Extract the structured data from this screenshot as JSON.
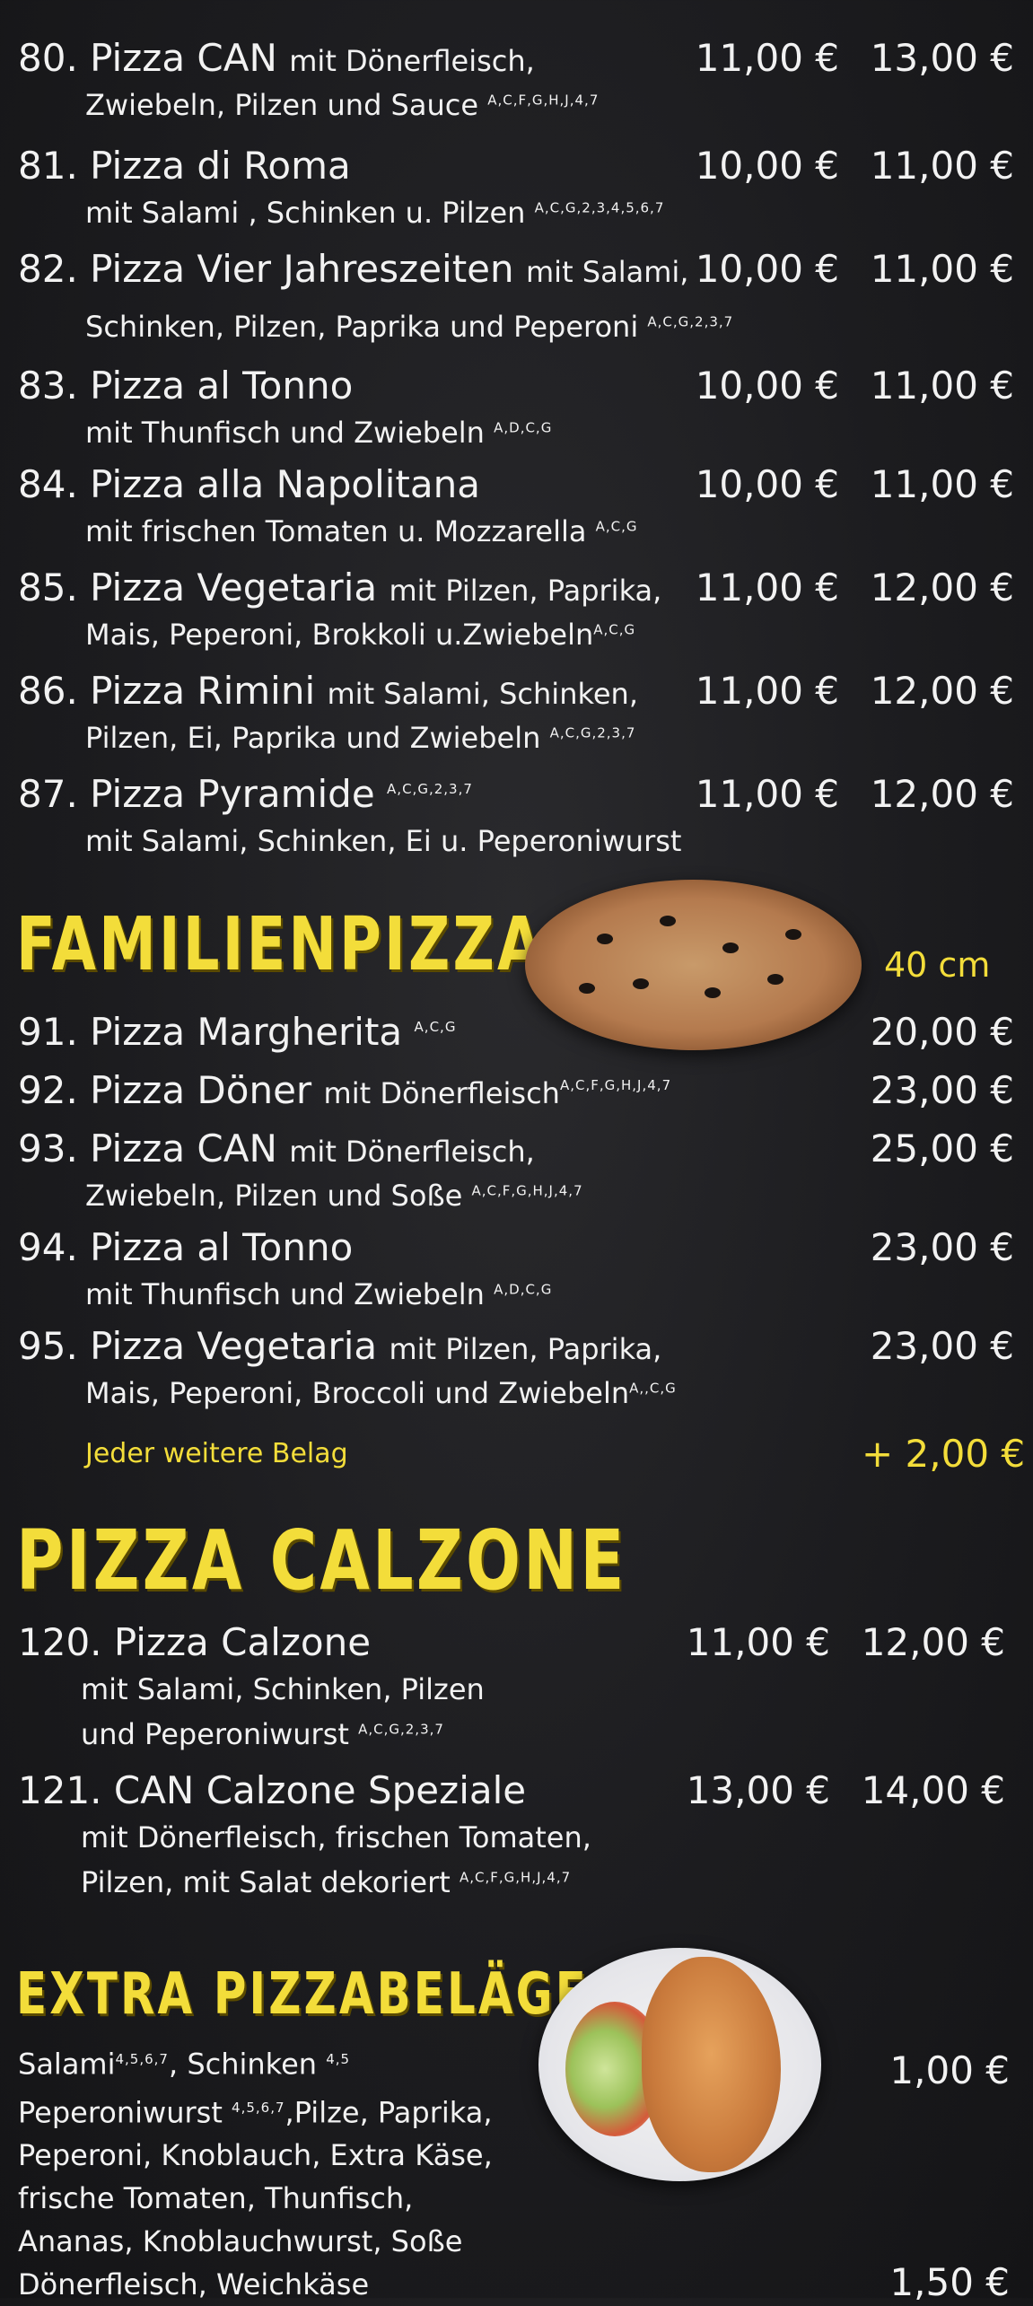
{
  "sections": {
    "normal_items": [
      {
        "num": "80.",
        "name": "Pizza CAN",
        "desc1": "mit Dönerfleisch,",
        "desc2": "Zwiebeln, Pilzen und  Sauce",
        "sup": "A,C,F,G,H,J,4,7",
        "price1": "11,00 €",
        "price2": "13,00 €"
      },
      {
        "num": "81.",
        "name": "Pizza di Roma",
        "desc2": "mit Salami , Schinken u. Pilzen",
        "sup": "A,C,G,2,3,4,5,6,7",
        "price1": "10,00 €",
        "price2": "11,00 €"
      },
      {
        "num": "82.",
        "name": "Pizza Vier Jahreszeiten",
        "desc1": "mit Salami,",
        "desc2": "Schinken, Pilzen, Paprika und Peperoni",
        "sup": "A,C,G,2,3,7",
        "price1": "10,00 €",
        "price2": "11,00 €"
      },
      {
        "num": "83.",
        "name": "Pizza al Tonno",
        "desc2": "mit Thunfisch und Zwiebeln",
        "sup": "A,D,C,G",
        "price1": "10,00 €",
        "price2": "11,00 €"
      },
      {
        "num": "84.",
        "name": "Pizza alla Napolitana",
        "desc2": "mit frischen Tomaten u. Mozzarella",
        "sup": "A,C,G",
        "price1": "10,00 €",
        "price2": "11,00 €"
      },
      {
        "num": "85.",
        "name": "Pizza Vegetaria",
        "desc1": "mit Pilzen, Paprika,",
        "desc2": "Mais, Peperoni, Brokkoli u.Zwiebeln",
        "sup": "A,C,G",
        "price1": "11,00 €",
        "price2": "12,00 €"
      },
      {
        "num": "86.",
        "name": "Pizza Rimini",
        "desc1": "mit Salami, Schinken,",
        "desc2": "Pilzen, Ei, Paprika und Zwiebeln",
        "sup": "A,C,G,2,3,7",
        "price1": "11,00 €",
        "price2": "12,00 €"
      },
      {
        "num": "87.",
        "name": "Pizza Pyramide",
        "sup_name": "A,C,G,2,3,7",
        "desc2": "mit Salami, Schinken, Ei u.  Peperoniwurst",
        "price1": "11,00 €",
        "price2": "12,00 €"
      }
    ],
    "familien": {
      "title": "FAMILIENPIZZA",
      "size": "40 cm",
      "items": [
        {
          "num": "91.",
          "name": "Pizza Margherita",
          "sup": "A,C,G",
          "price": "20,00 €"
        },
        {
          "num": "92.",
          "name": "Pizza Döner",
          "desc1": "mit Dönerfleisch",
          "sup": "A,C,F,G,H,J,4,7",
          "price": "23,00 €"
        },
        {
          "num": "93.",
          "name": "Pizza CAN",
          "desc1": "mit Dönerfleisch,",
          "desc2": "Zwiebeln, Pilzen und Soße",
          "sup2": "A,C,F,G,H,J,4,7",
          "price": "25,00 €"
        },
        {
          "num": "94.",
          "name": "Pizza al Tonno",
          "desc2": "mit Thunfisch und Zwiebeln",
          "sup2": "A,D,C,G",
          "price": "23,00 €"
        },
        {
          "num": "95.",
          "name": "Pizza Vegetaria",
          "desc1": "mit Pilzen, Paprika,",
          "desc2": "Mais, Peperoni, Broccoli und Zwiebeln",
          "sup2": "A,,C,G",
          "price": "23,00 €"
        }
      ],
      "extra_label": "Jeder weitere Belag",
      "extra_price": "+ 2,00 €"
    },
    "calzone": {
      "title": "PIZZA CALZONE",
      "items": [
        {
          "num": "120.",
          "name": "Pizza Calzone",
          "desc1": "mit Salami, Schinken, Pilzen",
          "desc2": "und Peperoniwurst",
          "sup": "A,C,G,2,3,7",
          "price1": "11,00 €",
          "price2": "12,00 €"
        },
        {
          "num": "121.",
          "name": "CAN Calzone Speziale",
          "desc1": "mit Dönerfleisch, frischen Tomaten,",
          "desc2": "Pilzen, mit Salat dekoriert",
          "sup": "A,C,F,G,H,J,4,7",
          "price1": "13,00 €",
          "price2": "14,00 €"
        }
      ]
    },
    "extras": {
      "title": "EXTRA PIZZABELÄGE",
      "line1a": "Salami",
      "sup1a": "4,5,6,7",
      "line1b": ", Schinken",
      "sup1b": "4,5",
      "line2a": "Peperoniwurst",
      "sup2a": "4,5,6,7",
      "line2b": ",Pilze, Paprika,",
      "line3": "Peperoni, Knoblauch, Extra Käse,",
      "line4": "frische Tomaten, Thunfisch,",
      "line5": "Ananas, Knoblauchwurst, Soße",
      "line6": "Dönerfleisch, Weichkäse",
      "price1": "1,00 €",
      "price2": "1,50 €"
    }
  }
}
